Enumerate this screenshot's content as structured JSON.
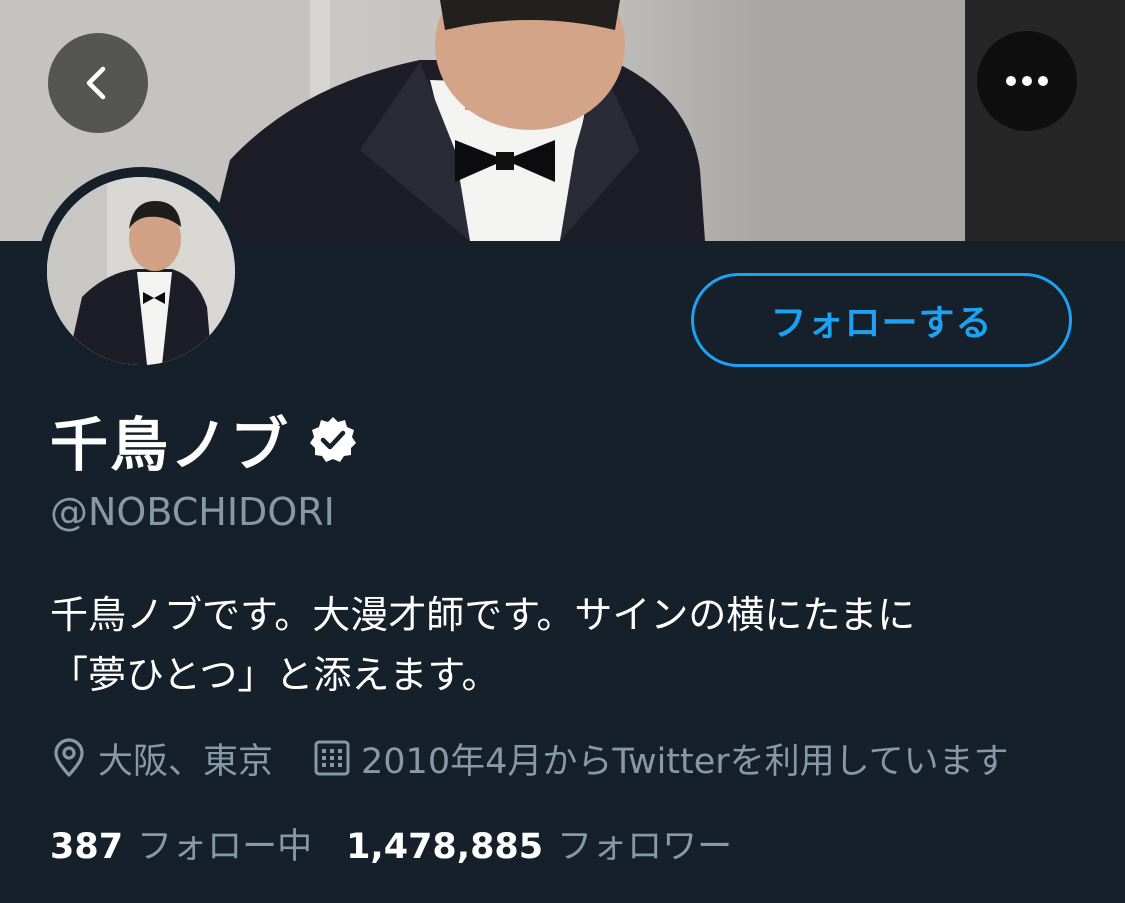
{
  "header": {
    "back_icon": "chevron-left-icon",
    "more_icon": "more-horizontal-icon"
  },
  "profile": {
    "follow_button_label": "フォローする",
    "display_name": "千鳥ノブ",
    "verified_icon": "verified-badge-icon",
    "handle": "@NOBCHIDORI",
    "bio_line1": "千鳥ノブです。大漫才師です。サインの横にたまに",
    "bio_line2": "「夢ひとつ」と添えます。",
    "location_icon": "location-pin-icon",
    "location": "大阪、東京",
    "joined_icon": "calendar-icon",
    "joined": "2010年4月からTwitterを利用しています",
    "following_count": "387",
    "following_label": "フォロー中",
    "followers_count": "1,478,885",
    "followers_label": "フォロワー"
  },
  "colors": {
    "background": "#15202b",
    "accent": "#1da1f2",
    "secondary_text": "#8899a6"
  }
}
